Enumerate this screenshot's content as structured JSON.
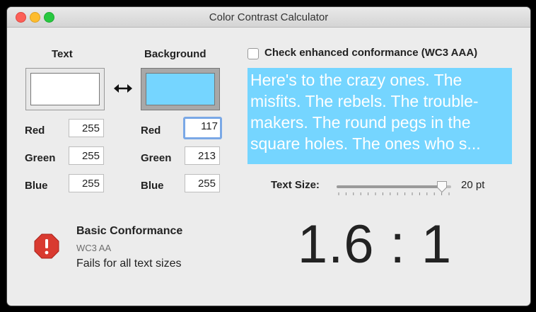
{
  "window": {
    "title": "Color Contrast Calculator"
  },
  "text_color": {
    "heading": "Text",
    "swatch": "#ffffff",
    "red_label": "Red",
    "red": "255",
    "green_label": "Green",
    "green": "255",
    "blue_label": "Blue",
    "blue": "255"
  },
  "background_color": {
    "heading": "Background",
    "swatch": "#75d5ff",
    "red_label": "Red",
    "red": "117",
    "green_label": "Green",
    "green": "213",
    "blue_label": "Blue",
    "blue": "255"
  },
  "enhanced": {
    "label": "Check enhanced conformance (WC3 AAA)",
    "checked": false
  },
  "preview": {
    "text": "Here's to the crazy ones. The misfits. The rebels. The trouble-makers. The round pegs in the square holes. The ones who s...",
    "text_color": "#ffffff",
    "background": "#75d5ff"
  },
  "text_size": {
    "label": "Text Size:",
    "value": "20 pt",
    "level": 0.92
  },
  "conformance": {
    "title": "Basic Conformance",
    "standard": "WC3 AA",
    "result": "Fails for all text sizes",
    "status_color": "#d93a30"
  },
  "ratio": "1.6 : 1"
}
